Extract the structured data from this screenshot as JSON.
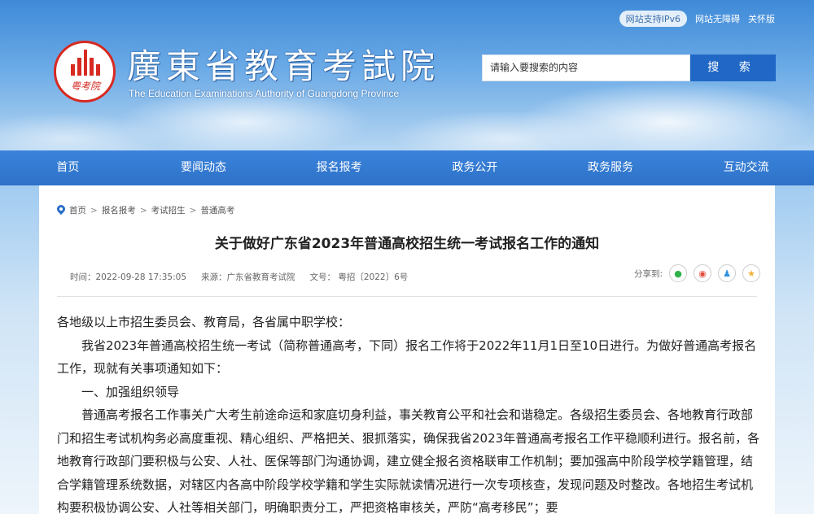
{
  "top_links": {
    "ipv6": "网站支持IPv6",
    "accessibility": "网站无障碍",
    "elderly": "关怀版"
  },
  "logo": {
    "title": "廣東省教育考試院",
    "subtitle": "The Education Examinations Authority of Guangdong Province",
    "seal_text": "粤考院"
  },
  "search": {
    "placeholder": "请输入要搜索的内容",
    "button": "搜 索"
  },
  "nav": [
    "首页",
    "要闻动态",
    "报名报考",
    "政务公开",
    "政务服务",
    "互动交流"
  ],
  "breadcrumb": [
    "首页",
    "报名报考",
    "考试招生",
    "普通高考"
  ],
  "article": {
    "title": "关于做好广东省2023年普通高校招生统一考试报名工作的通知",
    "time": "时间：2022-09-28 17:35:05",
    "source": "来源：广东省教育考试院",
    "doc_no": "文号：  粤招〔2022〕6号",
    "share_label": "分享到:",
    "paragraphs": [
      "各地级以上市招生委员会、教育局，各省属中职学校：",
      "我省2023年普通高校招生统一考试（简称普通高考，下同）报名工作将于2022年11月1日至10日进行。为做好普通高考报名工作，现就有关事项通知如下：",
      "一、加强组织领导",
      "普通高考报名工作事关广大考生前途命运和家庭切身利益，事关教育公平和社会和谐稳定。各级招生委员会、各地教育行政部门和招生考试机构务必高度重视、精心组织、严格把关、狠抓落实，确保我省2023年普通高考报名工作平稳顺利进行。报名前，各地教育行政部门要积极与公安、人社、医保等部门沟通协调，建立健全报名资格联审工作机制；要加强高中阶段学校学籍管理，结合学籍管理系统数据，对辖区内各高中阶段学校学籍和学生实际就读情况进行一次专项核查，发现问题及时整改。各地招生考试机构要积极协调公安、人社等相关部门，明确职责分工，严把资格审核关，严防“高考移民”；要"
    ]
  },
  "share_icons": [
    "wechat-icon",
    "weibo-icon",
    "qq-icon",
    "qzone-icon"
  ]
}
